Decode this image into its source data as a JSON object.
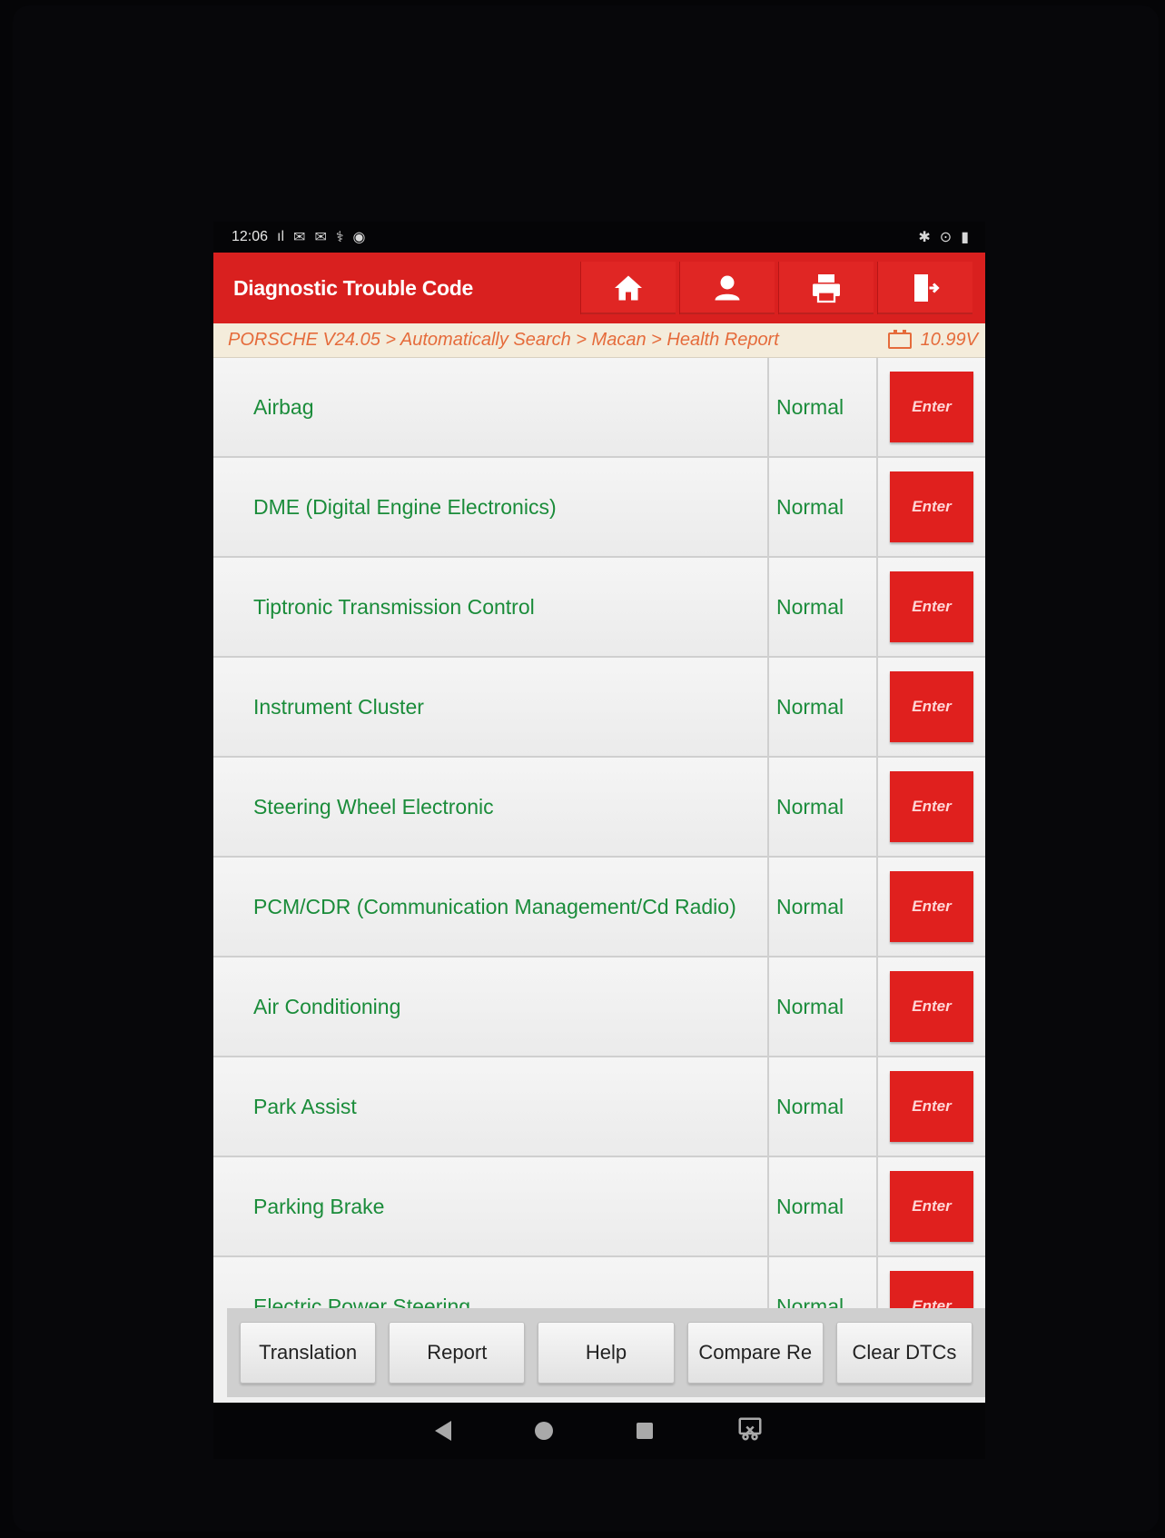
{
  "status_bar": {
    "time": "12:06",
    "left_icons": [
      "signal-icon",
      "mail-icon",
      "mail-icon",
      "diagnostic-icon",
      "accessibility-icon"
    ],
    "right_icons": [
      "bluetooth-icon",
      "location-icon",
      "battery-icon"
    ]
  },
  "header": {
    "title": "Diagnostic Trouble Code",
    "buttons": [
      "home-icon",
      "support-icon",
      "print-icon",
      "exit-icon"
    ]
  },
  "breadcrumb": {
    "path": "PORSCHE V24.05 > Automatically Search > Macan > Health Report",
    "voltage": "10.99V"
  },
  "systems": [
    {
      "name": "Airbag",
      "status": "Normal",
      "action": "Enter"
    },
    {
      "name": "DME (Digital Engine Electronics)",
      "status": "Normal",
      "action": "Enter"
    },
    {
      "name": "Tiptronic Transmission Control",
      "status": "Normal",
      "action": "Enter"
    },
    {
      "name": "Instrument Cluster",
      "status": "Normal",
      "action": "Enter"
    },
    {
      "name": "Steering Wheel Electronic",
      "status": "Normal",
      "action": "Enter"
    },
    {
      "name": "PCM/CDR (Communication Management/Cd Radio)",
      "status": "Normal",
      "action": "Enter"
    },
    {
      "name": "Air Conditioning",
      "status": "Normal",
      "action": "Enter"
    },
    {
      "name": "Park Assist",
      "status": "Normal",
      "action": "Enter"
    },
    {
      "name": "Parking Brake",
      "status": "Normal",
      "action": "Enter"
    },
    {
      "name": "Electric Power Steering",
      "status": "Normal",
      "action": "Enter"
    }
  ],
  "toolbar": {
    "translation": "Translation",
    "report": "Report",
    "help": "Help",
    "compare": "Compare Re",
    "clear_dtcs": "Clear DTCs"
  },
  "colors": {
    "accent": "#d9201f",
    "status_text": "#1a8c3a",
    "breadcrumb_text": "#e56b3b"
  }
}
